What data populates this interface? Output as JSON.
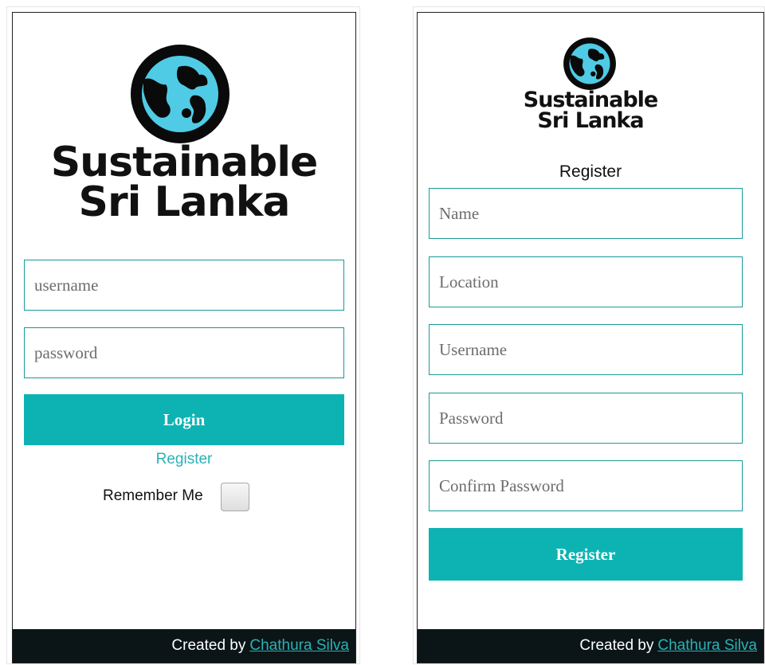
{
  "login": {
    "logo": {
      "line1": "Sustainable",
      "line2": "Sri Lanka",
      "icon": "globe-icon"
    },
    "username_placeholder": "username",
    "password_placeholder": "password",
    "login_label": "Login",
    "register_link": "Register",
    "remember_label": "Remember Me",
    "footer": {
      "prefix": "Created by",
      "author": "Chathura Silva"
    }
  },
  "register": {
    "logo": {
      "line1": "Sustainable",
      "line2": "Sri Lanka",
      "icon": "globe-icon"
    },
    "heading": "Register",
    "name_placeholder": "Name",
    "location_placeholder": "Location",
    "username_placeholder": "Username",
    "password_placeholder": "Password",
    "confirm_placeholder": "Confirm Password",
    "register_label": "Register",
    "footer": {
      "prefix": "Created by",
      "author": "Chathura Silva"
    }
  },
  "colors": {
    "accent": "#0db3b3",
    "field_border": "#1a9a96",
    "footer_bg": "#0b1517",
    "globe_water": "#4fcbe6"
  }
}
